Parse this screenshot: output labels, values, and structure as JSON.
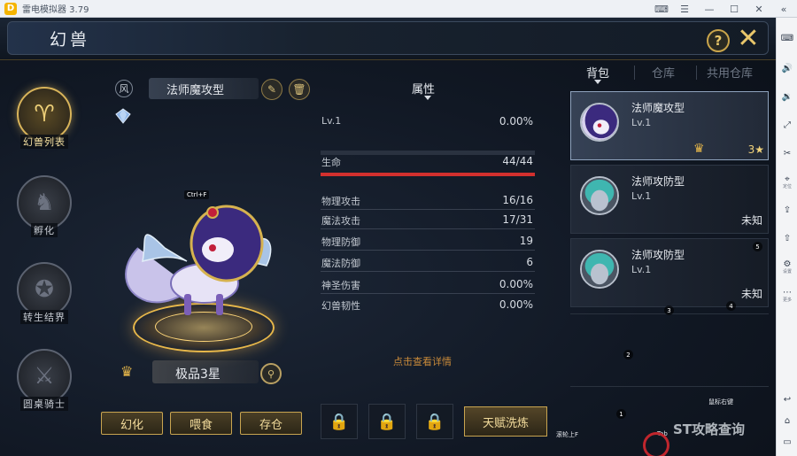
{
  "emulator": {
    "title": "雷电模拟器 3.79",
    "logo": "D",
    "controls": [
      "gamepad-icon",
      "menu-icon",
      "minimize-icon",
      "maximize-icon",
      "close-icon",
      "collapse-icon"
    ],
    "toolbar": [
      {
        "icon": "keyboard-icon",
        "label": ""
      },
      {
        "icon": "volume-up-icon",
        "label": ""
      },
      {
        "icon": "volume-down-icon",
        "label": ""
      },
      {
        "icon": "fullscreen-icon",
        "label": ""
      },
      {
        "icon": "scissors-icon",
        "label": ""
      },
      {
        "icon": "location-icon",
        "label": "定位"
      },
      {
        "icon": "install-icon",
        "label": ""
      },
      {
        "icon": "share-icon",
        "label": ""
      },
      {
        "icon": "settings-icon",
        "label": "设置"
      },
      {
        "icon": "more-icon",
        "label": "更多"
      },
      {
        "icon": "back-icon",
        "label": ""
      },
      {
        "icon": "home-icon",
        "label": ""
      },
      {
        "icon": "recent-icon",
        "label": ""
      }
    ]
  },
  "header": {
    "title": "幻兽",
    "help": "?",
    "close": "✕"
  },
  "nav": [
    {
      "label": "幻兽列表",
      "active": true
    },
    {
      "label": "孵化",
      "active": false
    },
    {
      "label": "转生结界",
      "active": false
    },
    {
      "label": "圆桌骑士",
      "active": false
    }
  ],
  "pet": {
    "element": "风",
    "name": "法师魔攻型",
    "grade": "极品3星",
    "ctrl_hint": "Ctrl+F",
    "actions": {
      "transform": "幻化",
      "feed": "喂食",
      "store": "存仓"
    }
  },
  "attributes": {
    "tab": "属性",
    "level_label": "Lv.1",
    "exp": "0.00%",
    "exp_fraction": 0.0,
    "hp_label": "生命",
    "hp": "44/44",
    "hp_fraction": 1.0,
    "stats": [
      {
        "label": "物理攻击",
        "value": "16/16"
      },
      {
        "label": "魔法攻击",
        "value": "17/31"
      },
      {
        "label": "物理防御",
        "value": "19"
      },
      {
        "label": "魔法防御",
        "value": "6"
      },
      {
        "label": "神圣伤害",
        "value": "0.00%"
      },
      {
        "label": "幻兽韧性",
        "value": "0.00%"
      }
    ],
    "details_link": "点击查看详情"
  },
  "talent": {
    "refine": "天赋洗炼"
  },
  "inventory": {
    "tabs": [
      "背包",
      "仓库",
      "共用仓库"
    ],
    "active_tab": 0,
    "items": [
      {
        "name": "法师魔攻型",
        "level": "Lv.1",
        "stars": "3",
        "status": "",
        "selected": true
      },
      {
        "name": "法师攻防型",
        "level": "Lv.1",
        "stars": "",
        "status": "未知",
        "selected": false
      },
      {
        "name": "法师攻防型",
        "level": "Lv.1",
        "stars": "",
        "status": "未知",
        "selected": false
      }
    ]
  },
  "hints": {
    "num1": "1",
    "num2": "2",
    "num3": "3",
    "num4": "4",
    "num5": "5",
    "tab_key": "Tab",
    "right_mouse": "鼠标右键",
    "f_key": "滚轮上F"
  },
  "watermark": "ST攻略查询"
}
